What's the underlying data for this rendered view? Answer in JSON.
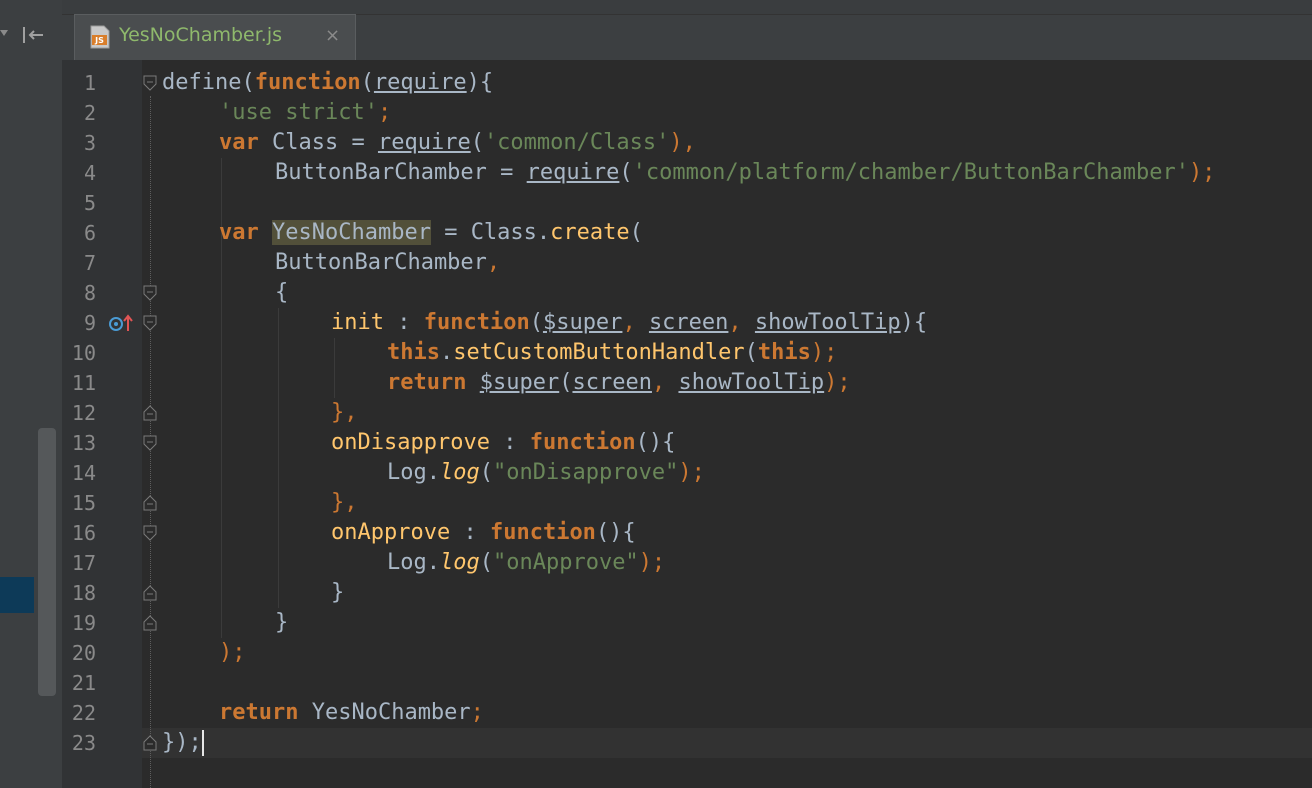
{
  "tab": {
    "filename": "YesNoChamber.js",
    "file_icon_label": "JS",
    "close_glyph": "×"
  },
  "colors": {
    "keyword": "#cc7832",
    "string": "#6a8759",
    "function": "#ffc66d",
    "default": "#a9b7c6",
    "tab_label": "#8fb96c"
  },
  "line_numbers": [
    "1",
    "2",
    "3",
    "4",
    "5",
    "6",
    "7",
    "8",
    "9",
    "10",
    "11",
    "12",
    "13",
    "14",
    "15",
    "16",
    "17",
    "18",
    "19",
    "20",
    "21",
    "22",
    "23"
  ],
  "code": {
    "l1": {
      "a": "define(",
      "b": "function",
      "c": "(",
      "d": "require",
      "e": "){"
    },
    "l2": {
      "a": "'use strict'",
      "b": ";"
    },
    "l3": {
      "a": "var",
      "b": " Class = ",
      "c": "require",
      "d": "(",
      "e": "'common/Class'",
      "f": "),"
    },
    "l4": {
      "a": "ButtonBarChamber = ",
      "b": "require",
      "c": "(",
      "d": "'common/platform/chamber/ButtonBarChamber'",
      "e": ");"
    },
    "l6": {
      "a": "var",
      "b": "YesNoChamber",
      "c": " = Class.",
      "d": "create",
      "e": "("
    },
    "l7": {
      "a": "ButtonBarChamber",
      "b": ","
    },
    "l8": {
      "a": "{"
    },
    "l9": {
      "a": "init",
      "b": " : ",
      "c": "function",
      "d": "(",
      "e": "$super",
      "f": ", ",
      "g": "screen",
      "h": ", ",
      "i": "showToolTip",
      "j": "){"
    },
    "l10": {
      "a": "this",
      "b": ".",
      "c": "setCustomButtonHandler",
      "d": "(",
      "e": "this",
      "f": ");"
    },
    "l11": {
      "a": "return",
      "b": " ",
      "c": "$super",
      "d": "(",
      "e": "screen",
      "f": ", ",
      "g": "showToolTip",
      "h": ");"
    },
    "l12": {
      "a": "},"
    },
    "l13": {
      "a": "onDisapprove",
      "b": " : ",
      "c": "function",
      "d": "(){"
    },
    "l14": {
      "a": "Log.",
      "b": "log",
      "c": "(",
      "d": "\"onDisapprove\"",
      "e": ");"
    },
    "l15": {
      "a": "},"
    },
    "l16": {
      "a": "onApprove",
      "b": " : ",
      "c": "function",
      "d": "(){"
    },
    "l17": {
      "a": "Log.",
      "b": "log",
      "c": "(",
      "d": "\"onApprove\"",
      "e": ");"
    },
    "l18": {
      "a": "}"
    },
    "l19": {
      "a": "}"
    },
    "l20": {
      "a": ");"
    },
    "l22": {
      "a": "return",
      "b": " YesNoChamber",
      "c": ";"
    },
    "l23": {
      "a": "});"
    }
  }
}
